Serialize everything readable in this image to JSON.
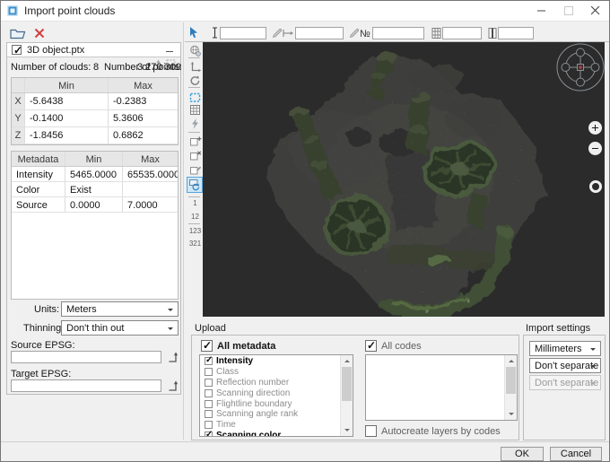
{
  "window": {
    "title": "Import point clouds"
  },
  "left_panel": {
    "file": {
      "name": "3D object.ptx"
    },
    "counts": {
      "clouds_label": "Number of clouds:",
      "clouds_value": "8",
      "points_label": "Number of points:",
      "points_value": "3 270 309"
    },
    "bounds_table": {
      "col_min": "Min",
      "col_max": "Max",
      "rows": [
        {
          "axis": "X",
          "min": "-5.6438",
          "max": "-0.2383"
        },
        {
          "axis": "Y",
          "min": "-0.1400",
          "max": "5.3606"
        },
        {
          "axis": "Z",
          "min": "-1.8456",
          "max": "0.6862"
        }
      ]
    },
    "metadata_table": {
      "col_meta": "Metadata",
      "col_min": "Min",
      "col_max": "Max",
      "rows": [
        {
          "name": "Intensity",
          "min": "5465.0000",
          "max": "65535.0000"
        },
        {
          "name": "Color",
          "min": "Exist",
          "max": ""
        },
        {
          "name": "Source",
          "min": "0.0000",
          "max": "7.0000"
        }
      ]
    },
    "units_label": "Units:",
    "units_value": "Meters",
    "thinning_label": "Thinning:",
    "thinning_value": "Don't thin out",
    "source_epsg_label": "Source EPSG:",
    "target_epsg_label": "Target EPSG:"
  },
  "viewport_toolbar": {
    "number_label": "№"
  },
  "tool_strip": {
    "s1": "1",
    "s12": "12",
    "s123": "123",
    "s321": "321"
  },
  "upload": {
    "title": "Upload",
    "all_metadata_label": "All metadata",
    "metadata_items": [
      {
        "label": "Intensity",
        "checked": true
      },
      {
        "label": "Class",
        "checked": false
      },
      {
        "label": "Reflection number",
        "checked": false
      },
      {
        "label": "Scanning direction",
        "checked": false
      },
      {
        "label": "Flightline boundary",
        "checked": false
      },
      {
        "label": "Scanning angle rank",
        "checked": false
      },
      {
        "label": "Time",
        "checked": false
      },
      {
        "label": "Scanning color",
        "checked": true
      }
    ],
    "all_codes_label": "All codes",
    "autocreate_label": "Autocreate layers by codes"
  },
  "import_settings": {
    "title": "Import settings",
    "unit_value": "Millimeters",
    "separate1_value": "Don't separate",
    "separate2_value": "Don't separate"
  },
  "footer": {
    "ok_label": "OK",
    "cancel_label": "Cancel"
  },
  "colors": {
    "accent_blue": "#2e7dbe",
    "viewport_bg": "#2b2b2b",
    "cloud_green": "#3a442f",
    "selected_tool_bg": "#cfe7f7",
    "selected_tool_border": "#55a4d9"
  }
}
